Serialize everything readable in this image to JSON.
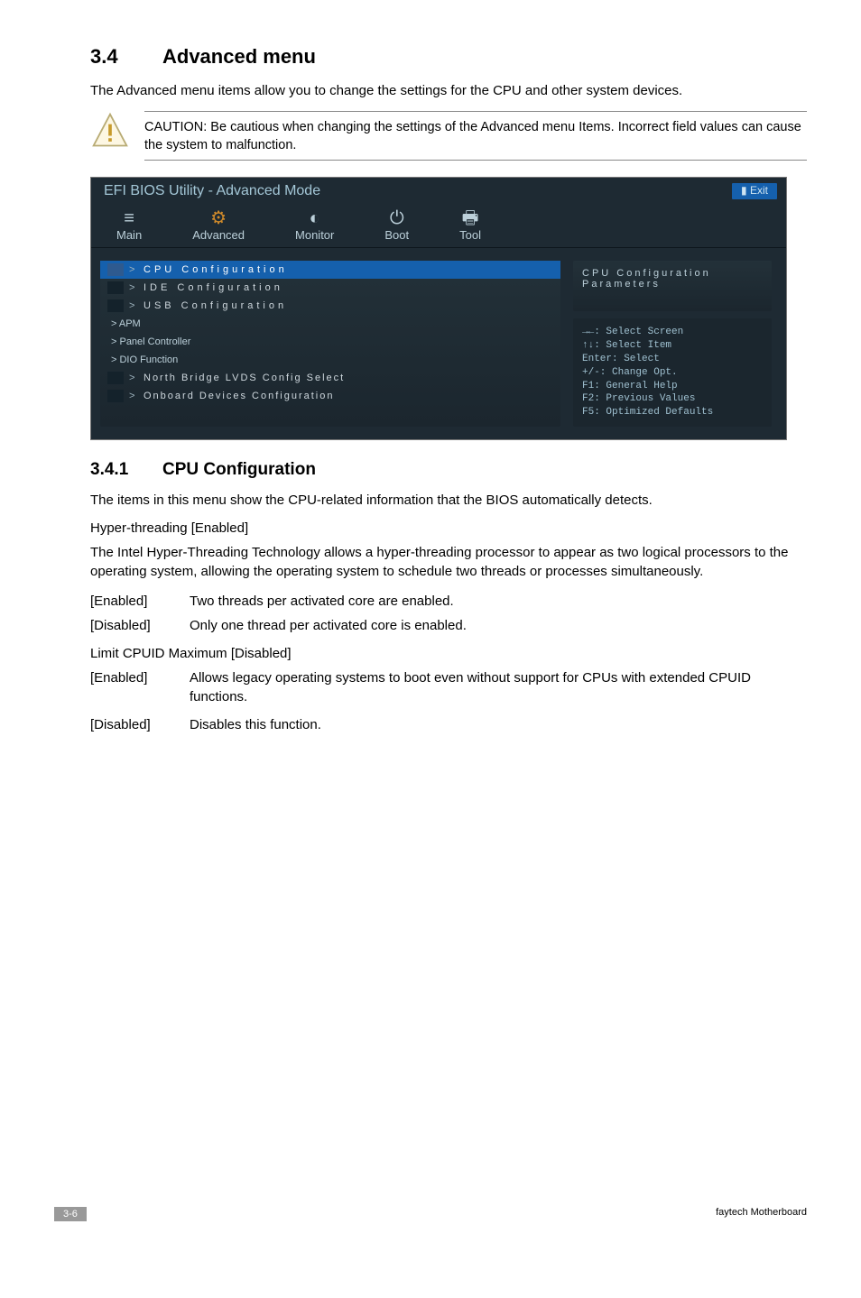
{
  "heading": {
    "num": "3.4",
    "title": "Advanced menu"
  },
  "intro": "The Advanced menu items allow you to change the settings for the CPU and other system devices.",
  "caution": "CAUTION: Be cautious when changing the settings of the Advanced menu Items. Incorrect field values can cause the system to malfunction.",
  "bios": {
    "title": "EFI BIOS Utility - Advanced Mode",
    "exit": "Exit",
    "tabs": {
      "main": "Main",
      "advanced": "Advanced",
      "monitor": "Monitor",
      "boot": "Boot",
      "tool": "Tool"
    },
    "menu": {
      "cpu": "CPU Configuration",
      "ide": "IDE Configuration",
      "usb": "USB Configuration",
      "apm": "> APM",
      "panel": "> Panel Controller",
      "dio": "> DIO Function",
      "lvds": "North Bridge LVDS Config Select",
      "onboard": "Onboard Devices Configuration"
    },
    "right_top": "CPU Configuration Parameters",
    "hints": {
      "l1": "→←: Select Screen",
      "l2": "↑↓: Select Item",
      "l3": "Enter: Select",
      "l4": "+/-: Change Opt.",
      "l5": "F1: General Help",
      "l6": "F2: Previous Values",
      "l7": "F5: Optimized Defaults"
    }
  },
  "sub": {
    "num": "3.4.1",
    "title": "CPU   Configuration"
  },
  "sub_p1": "The items in this menu show the CPU-related information that the BIOS automatically detects.",
  "setting1_title": "Hyper-threading [Enabled]",
  "setting1_p": "The Intel Hyper-Threading Technology allows a hyper-threading processor to appear as two logical processors to the operating system, allowing the operating system to schedule two threads or processes simultaneously.",
  "s1_opts": {
    "enabled_k": "[Enabled]",
    "enabled_v": "Two threads per activated core are enabled.",
    "disabled_k": "[Disabled]",
    "disabled_v": "Only one thread per activated core is enabled."
  },
  "setting2_title": "Limit CPUID Maximum [Disabled]",
  "s2_opts": {
    "enabled_k": "[Enabled]",
    "enabled_v": "Allows legacy operating systems to boot even without support for CPUs with extended CPUID functions.",
    "disabled_k": "[Disabled]",
    "disabled_v": "Disables this function."
  },
  "footer": {
    "page": "3-6",
    "brand": "faytech Motherboard"
  }
}
